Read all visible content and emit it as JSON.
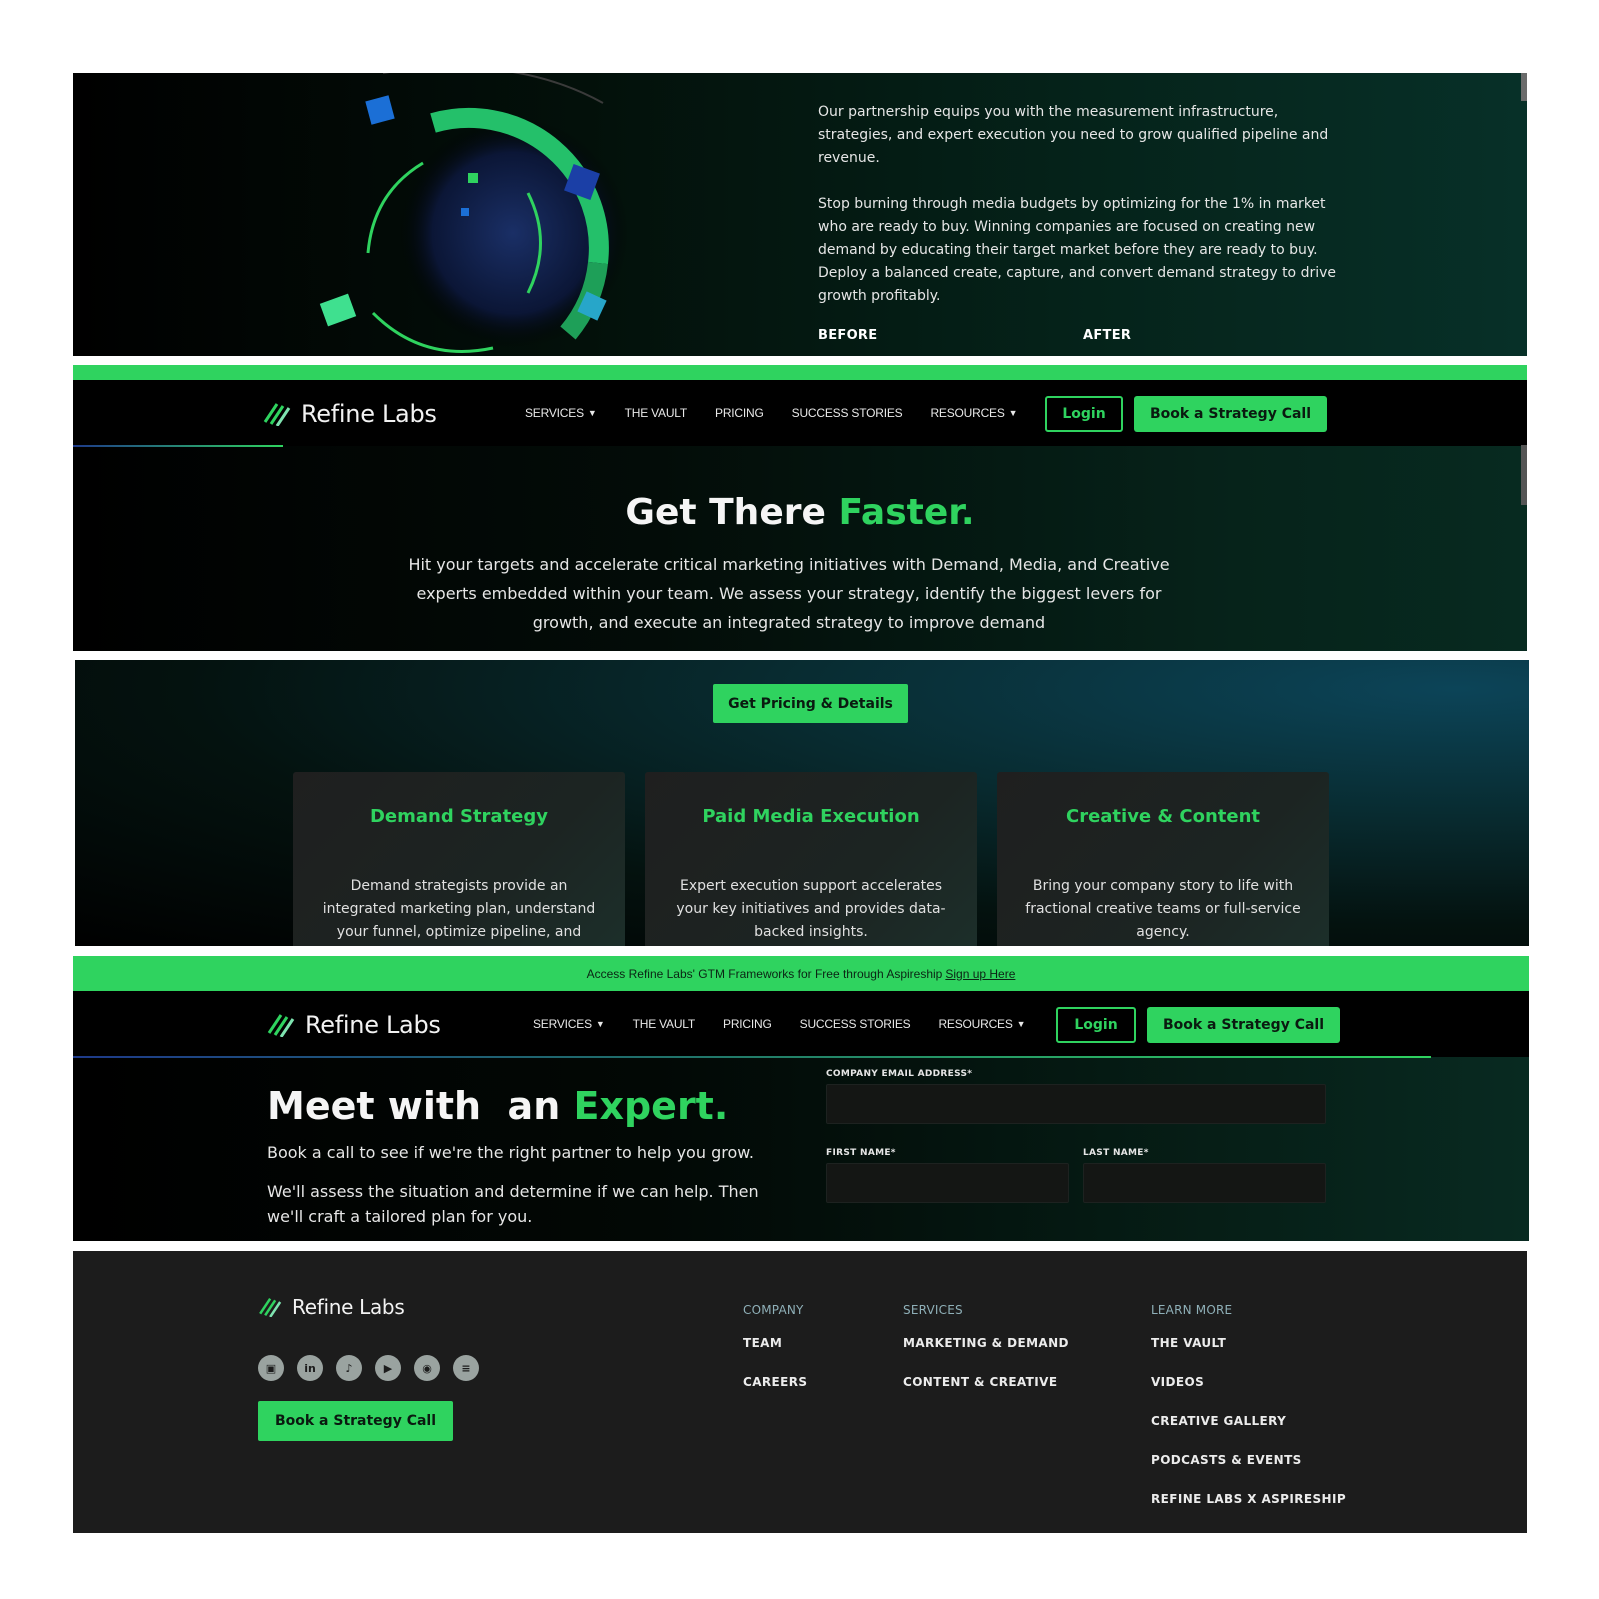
{
  "brand": {
    "name": "Refine Labs",
    "green": "#2fd35f",
    "dark": "#000000"
  },
  "nav": {
    "links": [
      "SERVICES",
      "THE VAULT",
      "PRICING",
      "SUCCESS STORIES",
      "RESOURCES"
    ],
    "login": "Login",
    "cta": "Book a Strategy Call"
  },
  "panel1": {
    "para1": "Our partnership equips you with the measurement infrastructure, strategies, and expert execution you need to grow qualified pipeline and revenue.",
    "para2": "Stop burning through media budgets by optimizing for the 1% in market who are ready to buy. Winning companies are focused on creating new demand by educating their target market before they are ready to buy. Deploy a balanced create, capture, and convert demand strategy to drive growth profitably.",
    "before": "BEFORE",
    "after": "AFTER"
  },
  "panel2": {
    "title_main": "Get There ",
    "title_accent": "Faster.",
    "lead": "Hit your targets and accelerate critical marketing initiatives with Demand, Media, and Creative experts embedded within your team.  We assess your strategy, identify the biggest levers for growth, and execute an integrated strategy to improve demand"
  },
  "panel3": {
    "cta": "Get Pricing & Details",
    "cards": [
      {
        "title": "Demand Strategy",
        "body": "Demand strategists provide an integrated marketing plan, understand your funnel, optimize pipeline, and"
      },
      {
        "title": "Paid Media Execution",
        "body": "Expert execution support accelerates your key initiatives and provides data-backed insights."
      },
      {
        "title": "Creative & Content",
        "body": "Bring your company story to life with fractional creative teams or full-service agency."
      }
    ]
  },
  "panel4": {
    "announce_text": "Access Refine Labs' GTM Frameworks for Free through Aspireship",
    "announce_link": "Sign up Here",
    "title_main": "Meet with  an ",
    "title_accent": "Expert.",
    "sub1": "Book a call to see if we're the right partner to help you grow.",
    "sub2": "We'll assess the situation and determine if we can help. Then we'll craft a tailored plan for you.",
    "form": {
      "email_label": "COMPANY EMAIL ADDRESS*",
      "first_label": "FIRST NAME*",
      "last_label": "LAST NAME*"
    }
  },
  "footer": {
    "social_icons": [
      "instagram-icon",
      "linkedin-icon",
      "tiktok-icon",
      "youtube-icon",
      "podcast-icon",
      "spotify-icon"
    ],
    "cta": "Book a Strategy Call",
    "columns": [
      {
        "heading": "COMPANY",
        "links": [
          "TEAM",
          "CAREERS"
        ]
      },
      {
        "heading": "SERVICES",
        "links": [
          "MARKETING & DEMAND",
          "CONTENT & CREATIVE"
        ]
      },
      {
        "heading": "LEARN MORE",
        "links": [
          "THE VAULT",
          "VIDEOS",
          "CREATIVE GALLERY",
          "PODCASTS & EVENTS",
          "REFINE LABS X ASPIRESHIP"
        ]
      }
    ]
  }
}
